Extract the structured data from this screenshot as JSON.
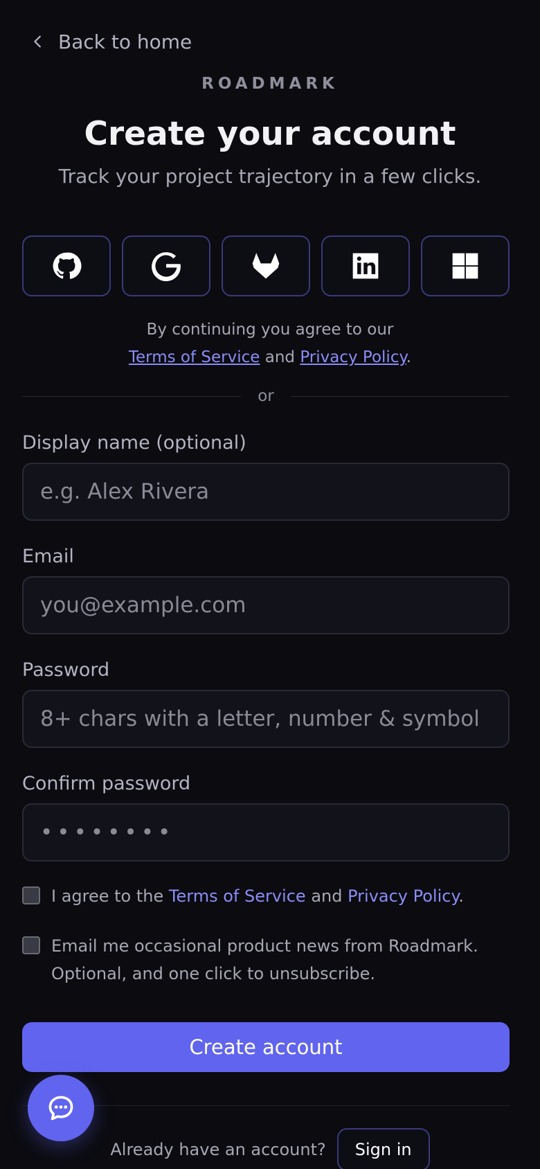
{
  "nav": {
    "back_label": "Back to home"
  },
  "brand": "ROADMARK",
  "title": "Create your account",
  "subtitle": "Track your project trajectory in a few clicks.",
  "social_providers": [
    "github-icon",
    "google-icon",
    "gitlab-icon",
    "linkedin-icon",
    "microsoft-icon"
  ],
  "consent": {
    "line1": "By continuing you agree to our",
    "terms": "Terms of Service",
    "and": "and",
    "privacy": "Privacy Policy",
    "period": "."
  },
  "divider": "or",
  "form": {
    "display_name": {
      "label": "Display name (optional)",
      "placeholder": "e.g. Alex Rivera",
      "value": ""
    },
    "email": {
      "label": "Email",
      "placeholder": "you@example.com",
      "value": ""
    },
    "password": {
      "label": "Password",
      "placeholder": "8+ chars with a letter, number & symbol",
      "value": ""
    },
    "confirm": {
      "label": "Confirm password",
      "value": "••••••••"
    }
  },
  "agree": {
    "prefix": "I agree to the",
    "terms": "Terms of Service",
    "and": "and",
    "privacy": "Privacy Policy",
    "period": ".",
    "checked": false
  },
  "newsletter": {
    "line1": "Email me occasional product news from Roadmark.",
    "line2": "Optional, and one click to unsubscribe.",
    "checked": false
  },
  "submit_label": "Create account",
  "signin": {
    "prompt": "Already have an account?",
    "button": "Sign in"
  },
  "colors": {
    "background": "#0b0b10",
    "accent": "#6164ee",
    "link": "#8b8cf5"
  }
}
